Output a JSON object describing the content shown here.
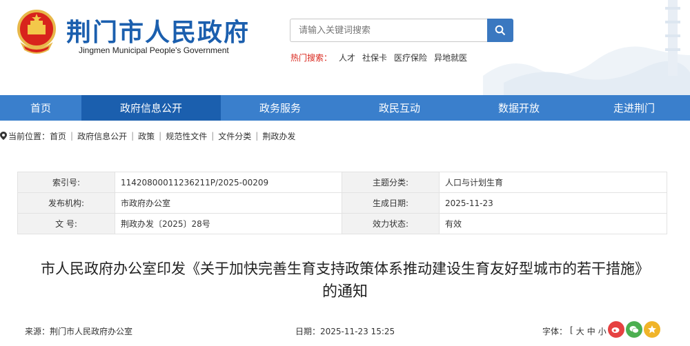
{
  "header": {
    "title": "荆门市人民政府",
    "subtitle": "Jingmen Municipal People's Government"
  },
  "search": {
    "placeholder": "请输入关键词搜索",
    "hot_label": "热门搜索：",
    "hot_items": [
      "人才",
      "社保卡",
      "医疗保险",
      "异地就医"
    ]
  },
  "nav": {
    "items": [
      "首页",
      "政府信息公开",
      "政务服务",
      "政民互动",
      "数据开放",
      "走进荆门"
    ],
    "active": "政府信息公开"
  },
  "breadcrumb": {
    "label": "当前位置：",
    "items": [
      "首页",
      "政府信息公开",
      "政策",
      "规范性文件",
      "文件分类",
      "荆政办发"
    ]
  },
  "meta": {
    "rows": [
      {
        "k1": "索引号:",
        "v1": "11420800011236211P/2025-00209",
        "k2": "主题分类:",
        "v2": "人口与计划生育"
      },
      {
        "k1": "发布机构:",
        "v1": "市政府办公室",
        "k2": "生成日期:",
        "v2": "2025-11-23"
      },
      {
        "k1": "文 号:",
        "v1": "荆政办发〔2025〕28号",
        "k2": "效力状态:",
        "v2": "有效"
      }
    ]
  },
  "document": {
    "title_line1": "市人民政府办公室印发《关于加快完善生育支持政策体系推动建设生育友好型城市的若干措施》",
    "title_line2": "的通知"
  },
  "footer": {
    "source": "来源：荆门市人民政府办公室",
    "date": "日期：2025-11-23 15:25",
    "font_label": "字体：",
    "font_options": [
      "[",
      "大",
      "中",
      "小",
      "]"
    ]
  },
  "colors": {
    "brand_blue": "#1b5fae",
    "nav_blue": "#3a7fcc",
    "hot_red": "#d9261c"
  }
}
